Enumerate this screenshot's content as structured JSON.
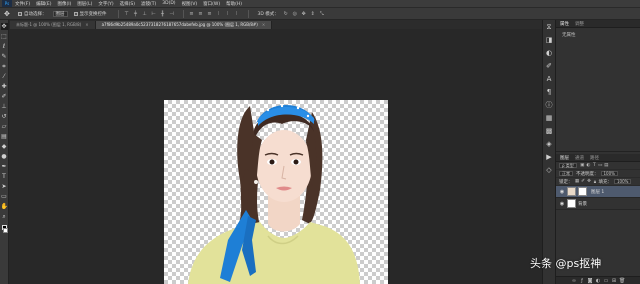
{
  "app": {
    "logo": "Ps",
    "menus": [
      "文件(F)",
      "编辑(E)",
      "图像(I)",
      "图层(L)",
      "文字(Y)",
      "选择(S)",
      "滤镜(T)",
      "3D(D)",
      "视图(V)",
      "窗口(W)",
      "帮助(H)"
    ]
  },
  "options_bar": {
    "auto_select_label": "自动选择：",
    "auto_select_value": "图层",
    "show_transform_label": "显示变换控件",
    "mode_3d_label": "3D 模式："
  },
  "tabs": [
    {
      "label": "未标题-1 @ 100% (图层 1, RGB/8)",
      "active": false
    },
    {
      "label": "a7f86d9b25489a0c5237318276187657dabefeb.jpg @ 100% (图层 1, RGB/8#)",
      "active": true
    }
  ],
  "toolbar": {
    "tools": [
      "move",
      "marquee",
      "lasso",
      "quick-select",
      "crop",
      "eyedropper",
      "healing",
      "brush",
      "stamp",
      "history-brush",
      "eraser",
      "gradient",
      "blur",
      "dodge",
      "pen",
      "type",
      "path-select",
      "shape",
      "hand",
      "zoom"
    ]
  },
  "properties_panel": {
    "tabs": [
      "属性",
      "调整"
    ],
    "empty_text": "无属性"
  },
  "layers_panel": {
    "tabs": [
      "图层",
      "通道",
      "路径"
    ],
    "filter_kind": "ρ 类型",
    "blend_mode": "正常",
    "opacity_label": "不透明度：",
    "opacity_value": "100%",
    "lock_label": "锁定：",
    "fill_label": "填充：",
    "fill_value": "100%",
    "layers": [
      {
        "name": "图层 1",
        "selected": true,
        "has_mask": true
      },
      {
        "name": "背景",
        "selected": false,
        "has_mask": false
      }
    ]
  },
  "watermark": "头条 @ps抠神",
  "colors": {
    "scarf_blue": "#1e7fd6",
    "sweater_yellow": "#e2e29a",
    "selected_layer": "#4e5a6e"
  }
}
